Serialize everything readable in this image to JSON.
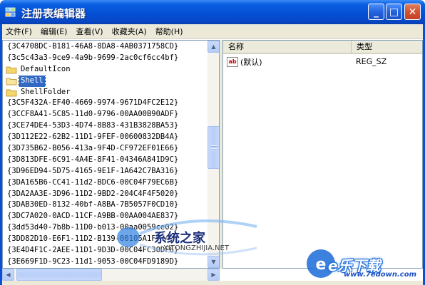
{
  "window": {
    "title": "注册表编辑器",
    "minimize_glyph": "_",
    "maximize_glyph": "□",
    "close_glyph": "✕"
  },
  "menu": {
    "items": [
      {
        "label": "文件(F)"
      },
      {
        "label": "编辑(E)"
      },
      {
        "label": "查看(V)"
      },
      {
        "label": "收藏夹(A)"
      },
      {
        "label": "帮助(H)"
      }
    ]
  },
  "tree": {
    "items": [
      {
        "label": "{3C4708DC-B181-46A8-8DA8-4AB0371758CD}",
        "folder": false,
        "selected": false
      },
      {
        "label": "{3c5c43a3-9ce9-4a9b-9699-2ac0cf6cc4bf}",
        "folder": false,
        "selected": false
      },
      {
        "label": "DefaultIcon",
        "folder": true,
        "selected": false
      },
      {
        "label": "Shell",
        "folder": true,
        "selected": true
      },
      {
        "label": "ShellFolder",
        "folder": true,
        "selected": false
      },
      {
        "label": "{3C5F432A-EF40-4669-9974-9671D4FC2E12}",
        "folder": false,
        "selected": false
      },
      {
        "label": "{3CCF8A41-5C85-11d0-9796-00AA00B90ADF}",
        "folder": false,
        "selected": false
      },
      {
        "label": "{3CE74DE4-53D3-4D74-8B83-431B3828BA53}",
        "folder": false,
        "selected": false
      },
      {
        "label": "{3D112E22-62B2-11D1-9FEF-00600832DB4A}",
        "folder": false,
        "selected": false
      },
      {
        "label": "{3D735B62-B056-413a-9F4D-CF972EF01E66}",
        "folder": false,
        "selected": false
      },
      {
        "label": "{3D813DFE-6C91-4A4E-8F41-04346A841D9C}",
        "folder": false,
        "selected": false
      },
      {
        "label": "{3D96ED94-5D75-4165-9E1F-1A642C7BA316}",
        "folder": false,
        "selected": false
      },
      {
        "label": "{3DA165B6-CC41-11d2-BDC6-00C04F79EC6B}",
        "folder": false,
        "selected": false
      },
      {
        "label": "{3DA2AA3E-3D96-11D2-9BD2-204C4F4F5020}",
        "folder": false,
        "selected": false
      },
      {
        "label": "{3DAB30ED-8132-40bf-A8BA-7B5057F0CD10}",
        "folder": false,
        "selected": false
      },
      {
        "label": "{3DC7A020-0ACD-11CF-A9BB-00AA004AE837}",
        "folder": false,
        "selected": false
      },
      {
        "label": "{3dd53d40-7b8b-11D0-b013-00aa0059ce02}",
        "folder": false,
        "selected": false
      },
      {
        "label": "{3DD82D10-E6F1-11D2-B139-00105A1F77A1}",
        "folder": false,
        "selected": false
      },
      {
        "label": "{3E4D4F1C-2AEE-11D1-9D3D-00C04FC30DF6}",
        "folder": false,
        "selected": false
      },
      {
        "label": "{3E669F1D-9C23-11d1-9053-00C04FD9189D}",
        "folder": false,
        "selected": false
      }
    ]
  },
  "list": {
    "headers": {
      "name": "名称",
      "type": "类型"
    },
    "rows": [
      {
        "name": "(默认)",
        "type": "REG_SZ",
        "icon": "ab-string-icon"
      }
    ]
  },
  "watermarks": {
    "site1": "系统之家",
    "site1_url": "XITONGZHIJIA.NET",
    "site2": "e乐下载",
    "site2_url": "www.7edown.com"
  },
  "colors": {
    "titlebar": "#0450d4",
    "selection": "#316ac5",
    "chrome": "#ece9d8"
  }
}
